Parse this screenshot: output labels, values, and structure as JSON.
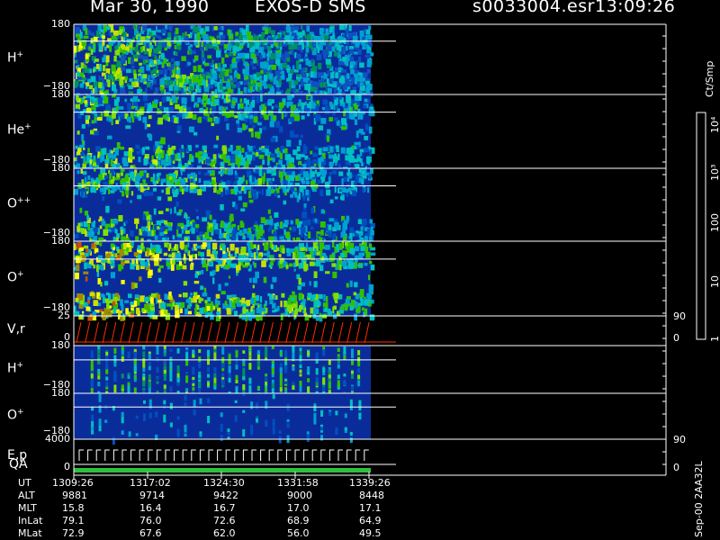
{
  "header": {
    "date": "Mar 30, 1990",
    "instrument": "EXOS-D SMS",
    "file": "s0033004.esr",
    "time": "13:09:26"
  },
  "colorbar": {
    "unit": "Ct/Smp",
    "ticks": [
      "10⁴",
      "10³",
      "100",
      "10",
      "1"
    ],
    "colors": [
      "#ffffff",
      "#6a0000",
      "#960000",
      "#c80000",
      "#ff1000",
      "#7a4a00",
      "#8a6a00",
      "#a08a00",
      "#c8c800",
      "#ffff00",
      "#c8f000",
      "#80e000",
      "#30d000",
      "#00b000",
      "#009070",
      "#00c0c0",
      "#0090d0",
      "#0050b0",
      "#1030a0",
      "#002090"
    ]
  },
  "panels": [
    {
      "id": "h-plus",
      "label": "H",
      "sup": "+",
      "top_tick": "180",
      "bottom_tick": "−180"
    },
    {
      "id": "he-plus",
      "label": "He",
      "sup": "+",
      "top_tick": "180",
      "bottom_tick": "−180"
    },
    {
      "id": "o-plusplus",
      "label": "O",
      "sup": "++",
      "top_tick": "180",
      "bottom_tick": "−180"
    },
    {
      "id": "o-plus",
      "label": "O",
      "sup": "+",
      "top_tick": "180",
      "bottom_tick": "−180"
    },
    {
      "id": "vr",
      "label": "V,r",
      "sup": "",
      "top_tick": "25",
      "bottom_tick": "0",
      "right_top": "90",
      "right_bottom": "0"
    },
    {
      "id": "h-plus-2",
      "label": "H",
      "sup": "+",
      "top_tick": "180",
      "bottom_tick": "−180"
    },
    {
      "id": "o-plus-2",
      "label": "O",
      "sup": "+",
      "top_tick": "180",
      "bottom_tick": "−180"
    },
    {
      "id": "ep",
      "label": "E,p",
      "sup": "",
      "top_tick": "4000",
      "bottom_tick": "0",
      "right_top": "90",
      "right_bottom": "0"
    }
  ],
  "qa_label": "QA",
  "footer": {
    "rows": [
      {
        "label": "UT",
        "values": [
          "1309:26",
          "1317:02",
          "1324:30",
          "1331:58",
          "1339:26"
        ]
      },
      {
        "label": "ALT",
        "values": [
          "9881",
          "9714",
          "9422",
          "9000",
          "8448"
        ]
      },
      {
        "label": "MLT",
        "values": [
          "15.8",
          "16.4",
          "16.7",
          "17.0",
          "17.1"
        ]
      },
      {
        "label": "InLat",
        "values": [
          "79.1",
          "76.0",
          "72.6",
          "68.9",
          "64.9"
        ]
      },
      {
        "label": "MLat",
        "values": [
          "72.9",
          "67.6",
          "62.0",
          "56.0",
          "49.5"
        ]
      }
    ]
  },
  "version": "Sep-00  2AA32L",
  "chart_data": {
    "type": "heatmap",
    "title": "Mar 30, 1990   EXOS-D SMS",
    "x": [
      "1309:26",
      "1317:02",
      "1324:30",
      "1331:58",
      "1339:26"
    ],
    "xlabel": "UT",
    "series": [
      {
        "name": "H+",
        "ylim": [
          -180,
          180
        ]
      },
      {
        "name": "He+",
        "ylim": [
          -180,
          180
        ]
      },
      {
        "name": "O++",
        "ylim": [
          -180,
          180
        ]
      },
      {
        "name": "O+",
        "ylim": [
          -180,
          180
        ]
      },
      {
        "name": "V,r",
        "ylim": [
          0,
          25
        ]
      },
      {
        "name": "H+",
        "ylim": [
          -180,
          180
        ]
      },
      {
        "name": "O+",
        "ylim": [
          -180,
          180
        ]
      },
      {
        "name": "E,p",
        "ylim": [
          0,
          4000
        ]
      }
    ],
    "colorbar": {
      "label": "Ct/Smp",
      "scale": "log",
      "range": [
        1,
        10000
      ]
    }
  }
}
